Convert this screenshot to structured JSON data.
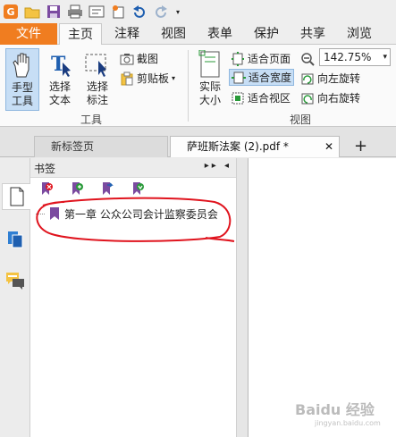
{
  "ribbon_tabs": [
    "文件",
    "主页",
    "注释",
    "视图",
    "表单",
    "保护",
    "共享",
    "浏览"
  ],
  "ribbon": {
    "hand_tool": "手型\n工具",
    "select_text": "选择\n文本",
    "select_annotation": "选择\n标注",
    "screenshot": "截图",
    "clipboard": "剪贴板",
    "group_tools": "工具",
    "actual_size": "实际\n大小",
    "fit_page": "适合页面",
    "fit_width": "适合宽度",
    "fit_visible": "适合视区",
    "zoom_value": "142.75%",
    "rotate_left": "向左旋转",
    "rotate_right": "向右旋转",
    "group_view": "视图"
  },
  "doc_tabs": [
    {
      "label": "新标签页",
      "active": false
    },
    {
      "label": "萨班斯法案 (2).pdf *",
      "active": true
    }
  ],
  "panel": {
    "title": "书签",
    "controls": "▸▸ ◂"
  },
  "bookmarks": [
    "第一章 公众公司会计监察委员会"
  ],
  "watermark": {
    "text": "Baidu 经验",
    "sub": "jingyan.baidu.com"
  },
  "colors": {
    "accent": "#f07d20",
    "annotation_circle": "#e0141e",
    "bookmark_purple": "#7b4aa0"
  }
}
